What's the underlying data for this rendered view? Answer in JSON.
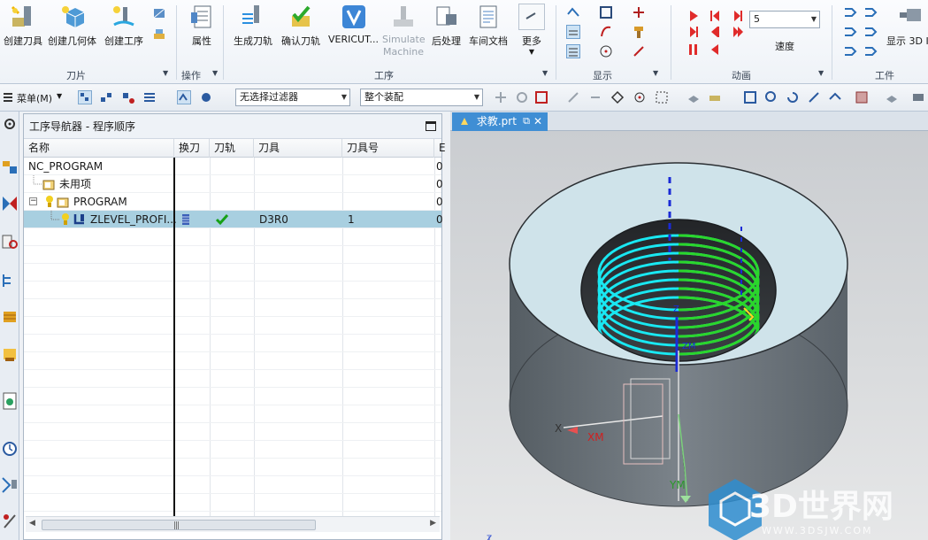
{
  "ribbon": {
    "groups": {
      "tool": "刀片",
      "operation": "操作",
      "process": "工序",
      "display": "显示",
      "animation": "动画",
      "workpiece": "工件"
    },
    "buttons": {
      "create_tool": "创建刀具",
      "create_geometry": "创建几何体",
      "create_operation": "创建工序",
      "properties": "属性",
      "generate_path": "生成刀轨",
      "verify_path": "确认刀轨",
      "vericut": "VERICUT...",
      "simulate_machine": "Simulate Machine",
      "postprocess": "后处理",
      "shop_doc": "车间文档",
      "more": "更多",
      "speed": "速度",
      "show_3d": "显示 3D I"
    },
    "speed_value": "5"
  },
  "toolbar": {
    "menu_label": "菜单(M)",
    "filter_value": "无选择过滤器",
    "assembly_value": "整个装配"
  },
  "navigator": {
    "title": "工序导航器 - 程序顺序",
    "columns": [
      "名称",
      "换刀",
      "刀轨",
      "刀具",
      "刀具号",
      "E"
    ],
    "rows": [
      {
        "name": "NC_PROGRAM",
        "last": "0"
      },
      {
        "name": "未用项",
        "last": "0"
      },
      {
        "name": "PROGRAM",
        "last": "0"
      },
      {
        "name": "ZLEVEL_PROFI...",
        "tool": "D3R0",
        "tool_no": "1",
        "last": "0"
      }
    ]
  },
  "graphics": {
    "tab_title": "求教.prt",
    "axis_labels": {
      "x": "X",
      "xm": "XM",
      "ym": "YM",
      "zm": "ZM",
      "z": "Z",
      "triad_z": "Z"
    },
    "watermark_title": "3D世界网",
    "watermark_url": "WWW.3DSJW.COM"
  },
  "colors": {
    "selection_row": "#a8cfe0",
    "tab_active": "#3f8ed4",
    "toolpath_cyan": "#19e8f2",
    "toolpath_green": "#2bd62b",
    "part_top": "#c8dde6",
    "part_side": "#6c747b"
  }
}
